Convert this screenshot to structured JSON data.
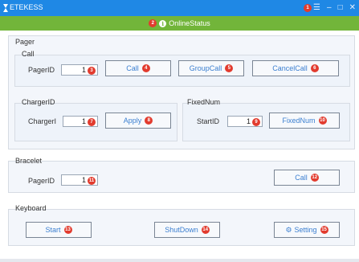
{
  "titlebar": {
    "title": "ETEKESS",
    "min_glyph": "–",
    "max_glyph": "□",
    "close_glyph": "✕",
    "menu_glyph": "☰",
    "badge": "1"
  },
  "status": {
    "text": "OnlineStatus",
    "badge": "2"
  },
  "pager": {
    "title": "Pager",
    "call": {
      "title": "Call",
      "pager_label": "PagerID",
      "pager_value": "1",
      "pager_badge": "3",
      "buttons": [
        {
          "label": "Call",
          "badge": "4"
        },
        {
          "label": "GroupCall",
          "badge": "5"
        },
        {
          "label": "CancelCall",
          "badge": "6"
        }
      ]
    },
    "charger": {
      "title": "ChargerID",
      "label": "ChargerI",
      "value": "1",
      "value_badge": "7",
      "apply_label": "Apply",
      "apply_badge": "8"
    },
    "fixednum": {
      "title": "FixedNum",
      "label": "StartID",
      "value": "1",
      "value_badge": "9",
      "button_label": "FixedNum",
      "button_badge": "10"
    }
  },
  "bracelet": {
    "title": "Bracelet",
    "label": "PagerID",
    "value": "1",
    "value_badge": "11",
    "call_label": "Call",
    "call_badge": "12"
  },
  "keyboard": {
    "title": "Keyboard",
    "start_label": "Start",
    "start_badge": "13",
    "shutdown_label": "ShutDown",
    "shutdown_badge": "14",
    "setting_label": "Setting",
    "setting_badge": "15"
  },
  "colors": {
    "titlebar": "#1f88e5",
    "statusbar": "#72b53a",
    "badge": "#e23b2e",
    "button_text": "#3b7fd0"
  },
  "icons": {
    "status": "info-icon",
    "setting": "gear-icon",
    "menu": "menu-icon"
  }
}
